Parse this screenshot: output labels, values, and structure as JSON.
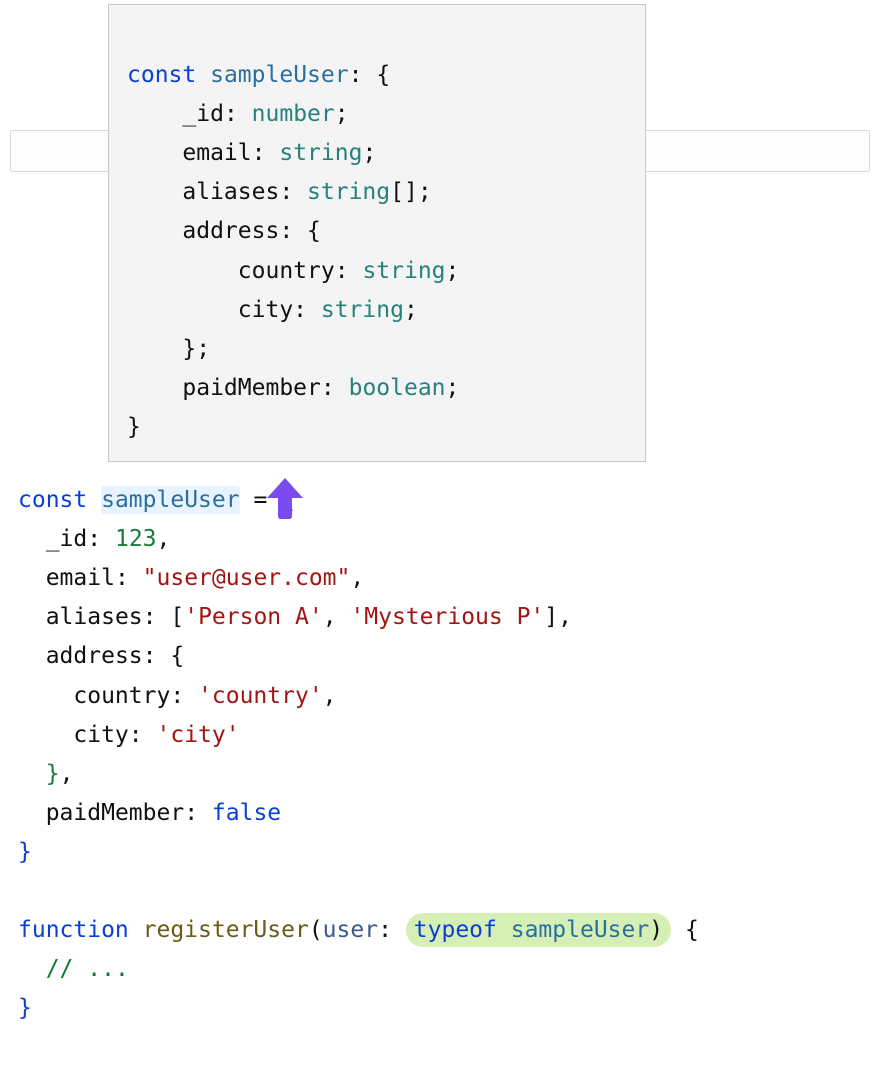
{
  "tooltip": {
    "kw_const": "const",
    "ident": "sampleUser",
    "p_id": "_id",
    "t_id": "number",
    "p_email": "email",
    "t_email": "string",
    "p_aliases": "aliases",
    "t_aliases": "string",
    "t_aliases_suffix": "[]",
    "p_address": "address",
    "p_country": "country",
    "t_country": "string",
    "p_city": "city",
    "t_city": "string",
    "p_paid": "paidMember",
    "t_paid": "boolean"
  },
  "editor": {
    "kw_const": "const",
    "ident": "sampleUser",
    "p_id": "_id",
    "v_id": "123",
    "p_email": "email",
    "v_email": "\"user@user.com\"",
    "p_aliases": "aliases",
    "v_alias1": "'Person A'",
    "v_alias2": "'Mysterious P'",
    "p_address": "address",
    "p_country": "country",
    "v_country": "'country'",
    "p_city": "city",
    "v_city": "'city'",
    "p_paid": "paidMember",
    "v_paid": "false",
    "kw_function": "function",
    "fn_name": "registerUser",
    "param": "user",
    "kw_typeof": "typeof",
    "ref": "sampleUser",
    "comment": "// ..."
  }
}
